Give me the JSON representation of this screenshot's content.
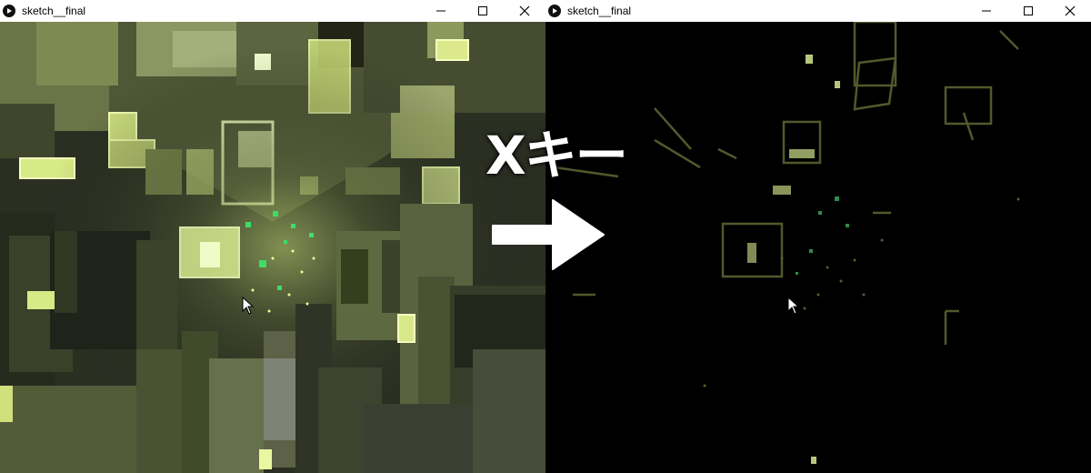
{
  "windows": [
    {
      "title": "sketch__final",
      "controls": {
        "minimize": "minimize-icon",
        "maximize": "maximize-icon",
        "close": "close-icon"
      }
    },
    {
      "title": "sketch__final",
      "controls": {
        "minimize": "minimize-icon",
        "maximize": "maximize-icon",
        "close": "close-icon"
      }
    }
  ],
  "overlay": {
    "key_label": "Xキー",
    "arrow_icon": "right-arrow-icon"
  },
  "colors": {
    "titlebar_bg": "#ffffff",
    "scene_dark": "#2f3326",
    "scene_olive": "#7d8a4e",
    "scene_glow": "#e8f7a0",
    "scene_green": "#3fdc6a",
    "after_bg": "#000000"
  }
}
